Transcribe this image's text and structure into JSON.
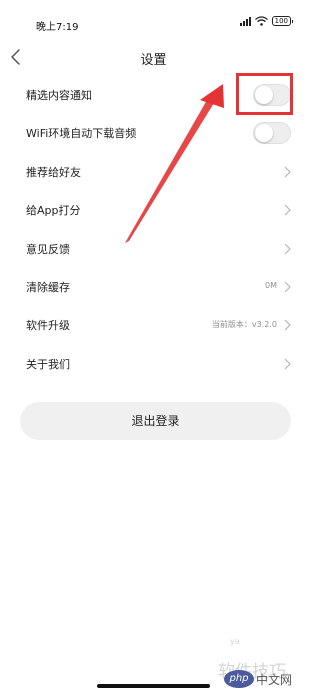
{
  "status_bar": {
    "time": "晚上7:19",
    "battery": "100"
  },
  "nav": {
    "title": "设置"
  },
  "settings": {
    "featured_notify": {
      "label": "精选内容通知",
      "enabled": false
    },
    "wifi_auto_download": {
      "label": "WiFi环境自动下载音频",
      "enabled": false
    },
    "recommend": {
      "label": "推荐给好友"
    },
    "rate_app": {
      "label": "给App打分"
    },
    "feedback": {
      "label": "意见反馈"
    },
    "clear_cache": {
      "label": "清除缓存",
      "value": "0M"
    },
    "upgrade": {
      "label": "软件升级",
      "value": "当前版本：v3.2.0"
    },
    "about": {
      "label": "关于我们"
    }
  },
  "logout": {
    "label": "退出登录"
  },
  "watermark": {
    "site": "ya",
    "tips": "软件技巧",
    "logo": "php",
    "cn": "中文网"
  },
  "colors": {
    "annotation": "#e33333",
    "toggle_off": "#eeeeee",
    "logout_bg": "#f0f0f0"
  },
  "icons": [
    "signal-icon",
    "wifi-icon",
    "battery-icon",
    "back-arrow-icon",
    "chevron-right-icon"
  ]
}
